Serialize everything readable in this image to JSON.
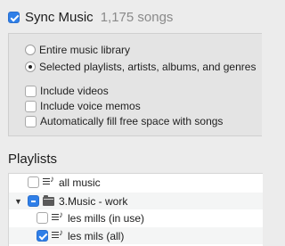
{
  "sync": {
    "checked": true,
    "title": "Sync Music",
    "count": "1,175 songs"
  },
  "options": {
    "scope": [
      {
        "label": "Entire music library",
        "selected": false
      },
      {
        "label": "Selected playlists, artists, albums, and genres",
        "selected": true
      }
    ],
    "checkboxes": [
      {
        "label": "Include videos",
        "checked": false
      },
      {
        "label": "Include voice memos",
        "checked": false
      },
      {
        "label": "Automatically fill free space with songs",
        "checked": false
      }
    ]
  },
  "playlists": {
    "heading": "Playlists",
    "items": [
      {
        "name": "all music",
        "state": "unchecked",
        "kind": "playlist",
        "level": 0
      },
      {
        "name": "3.Music - work",
        "state": "mixed",
        "kind": "folder",
        "level": 0,
        "expanded": true
      },
      {
        "name": "les mills (in use)",
        "state": "unchecked",
        "kind": "playlist",
        "level": 1
      },
      {
        "name": "les mils (all)",
        "state": "checked",
        "kind": "playlist",
        "level": 1
      }
    ]
  }
}
